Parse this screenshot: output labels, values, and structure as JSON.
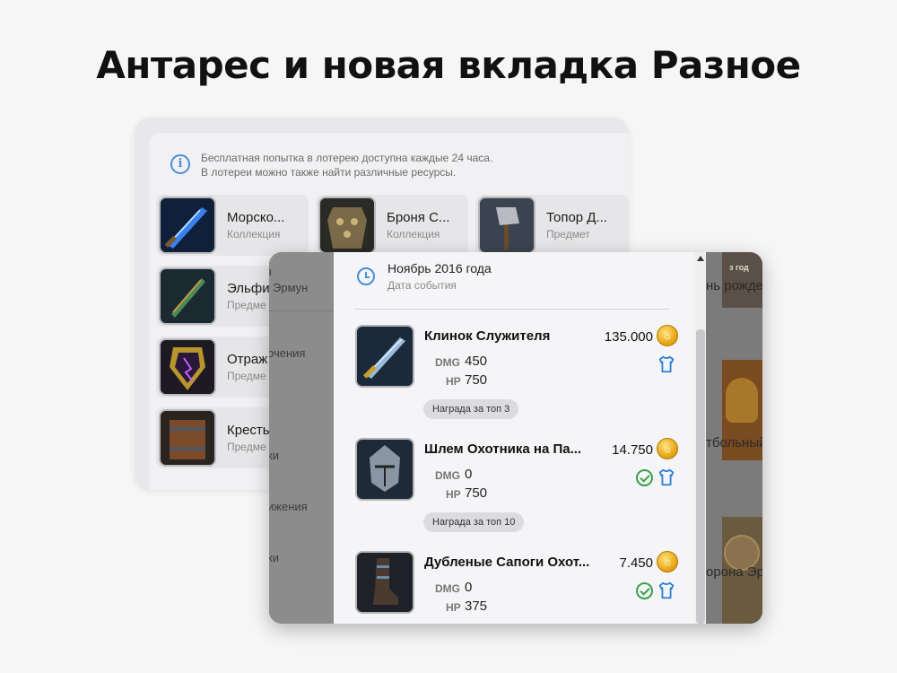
{
  "headline": "Антарес и новая вкладка Разное",
  "back_panel": {
    "info_line1": "Бесплатная попытка в лотерею доступна каждые 24 часа.",
    "info_line2": "В лотереи можно также найти различные ресурсы.",
    "items": [
      {
        "name": "Морско...",
        "type": "Коллекция",
        "icon": "blue-sword-icon"
      },
      {
        "name": "Броня С...",
        "type": "Коллекция",
        "icon": "armor-icon"
      },
      {
        "name": "Топор Д...",
        "type": "Предмет",
        "icon": "axe-icon"
      },
      {
        "name": "Эльфи",
        "type": "Предме",
        "icon": "green-sword-icon"
      },
      {
        "name": "Отраж",
        "type": "Предме",
        "icon": "shield-icon"
      },
      {
        "name": "Кресть",
        "type": "Предме",
        "icon": "crossbow-shield-icon"
      }
    ]
  },
  "dim_left": {
    "texts": [
      "в",
      "Эрмун",
      "очения",
      "ки",
      "ижения",
      "ки"
    ]
  },
  "dim_right": {
    "texts": [
      "з год",
      "нь рожде",
      "тбольный",
      "орона Эр"
    ]
  },
  "popup": {
    "event_date": "Ноябрь 2016 года",
    "event_label": "Дата события",
    "rewards": [
      {
        "name": "Клинок Служителя",
        "price": "135.000",
        "dmg": "450",
        "hp": "750",
        "badge": "Награда за топ 3",
        "owned": false,
        "icon": "blade-icon"
      },
      {
        "name": "Шлем Охотника на Па...",
        "price": "14.750",
        "dmg": "0",
        "hp": "750",
        "badge": "Награда за топ 10",
        "owned": true,
        "icon": "helmet-icon"
      },
      {
        "name": "Дубленые Сапоги Охот...",
        "price": "7.450",
        "dmg": "0",
        "hp": "375",
        "badge": "",
        "owned": true,
        "icon": "boots-icon"
      }
    ],
    "dmg_label": "DMG",
    "hp_label": "HP"
  },
  "colors": {
    "accent": "#4a8ed8",
    "check": "#3aa04a",
    "coin": "#e8a818"
  }
}
